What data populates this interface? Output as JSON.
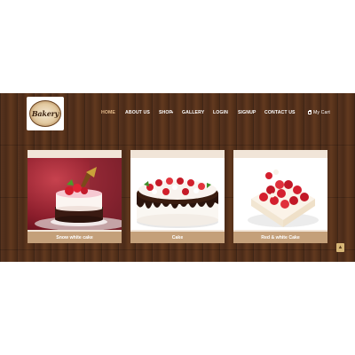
{
  "logo": {
    "text": "Bakery"
  },
  "nav": {
    "items": [
      {
        "label": "HOME",
        "active": true
      },
      {
        "label": "ABOUT US"
      },
      {
        "label": "SHOP"
      },
      {
        "label": "GALLERY"
      },
      {
        "label": "LOGIN"
      },
      {
        "label": "SIGNUP"
      },
      {
        "label": "CONTACT US"
      }
    ],
    "cart_label": "My Cart",
    "shop_arrow": "▾"
  },
  "products": [
    {
      "name": "Snow white cake"
    },
    {
      "name": "Cake"
    },
    {
      "name": "Red & white Cake"
    }
  ],
  "scroll_top_icon": "▲",
  "colors": {
    "wood": "#4a2a17",
    "active_nav": "#e2b98a",
    "card_bg": "#f1e5d8",
    "caption_bg": "#c4a07a",
    "scroll_btn": "#d7b676"
  }
}
